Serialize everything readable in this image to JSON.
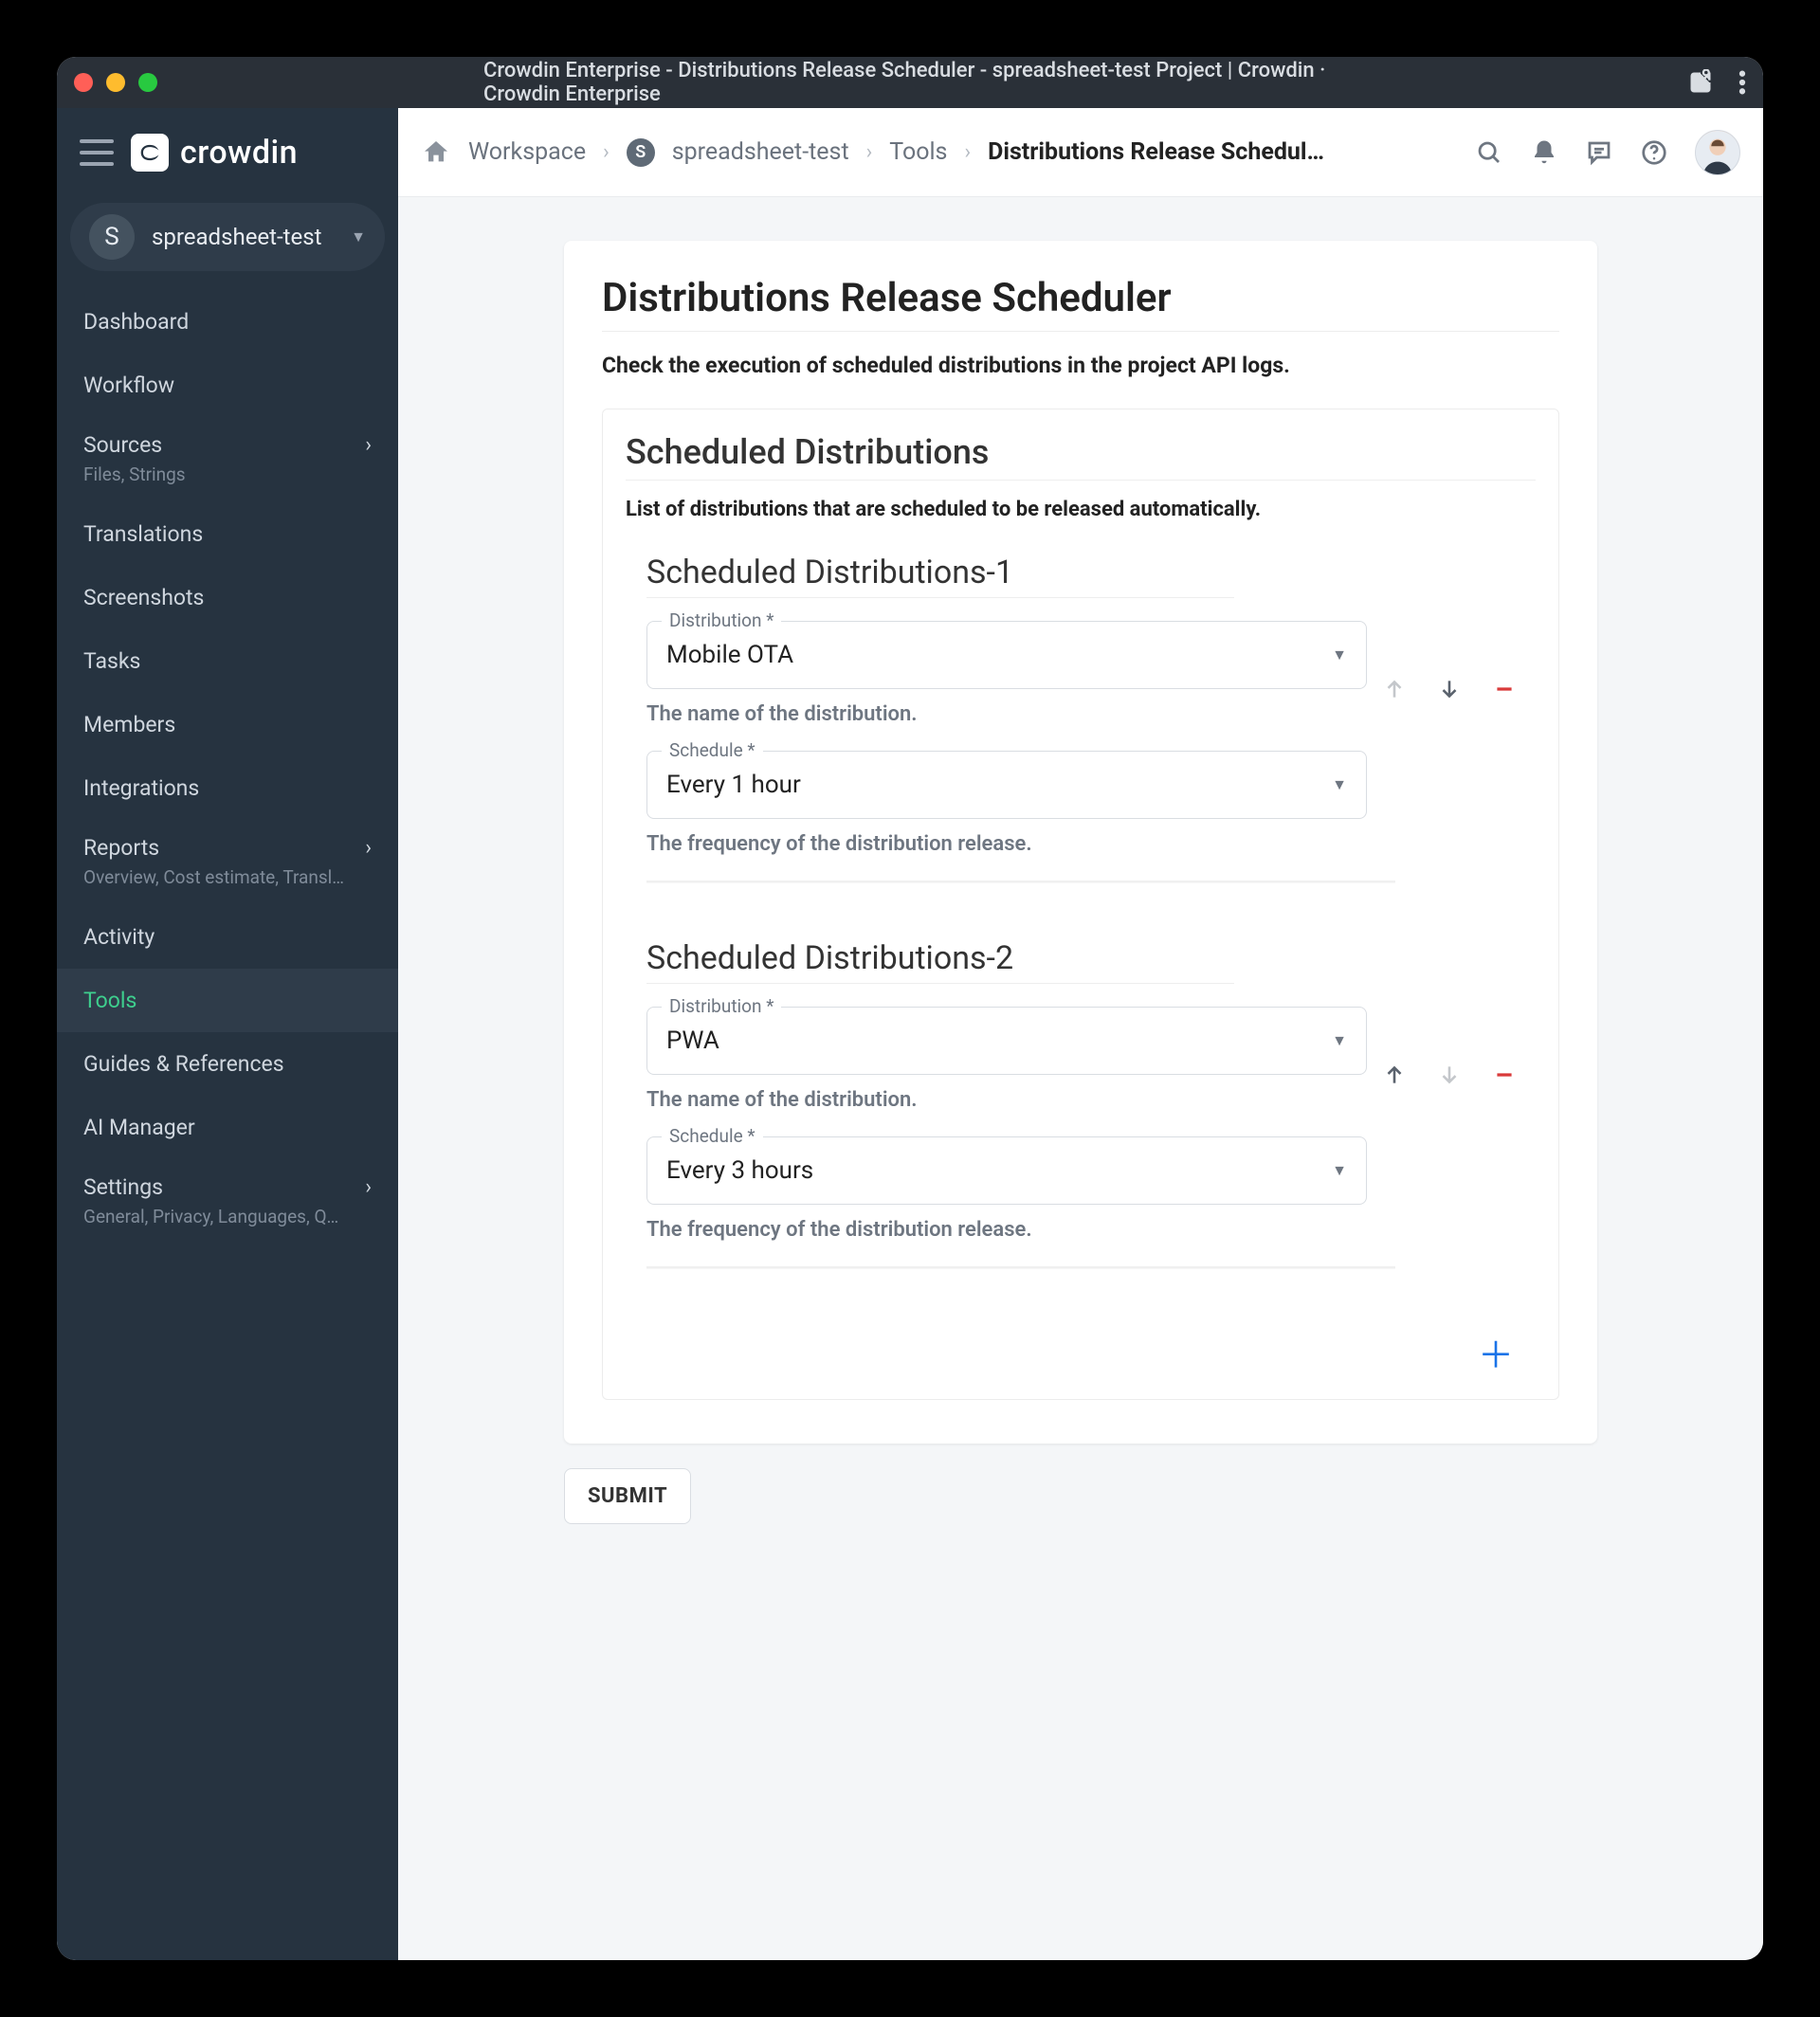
{
  "window": {
    "title": "Crowdin Enterprise - Distributions Release Scheduler - spreadsheet-test Project | Crowdin · Crowdin Enterprise"
  },
  "logo_text": "crowdin",
  "project": {
    "initial": "S",
    "name": "spreadsheet-test"
  },
  "sidebar": {
    "items": [
      {
        "label": "Dashboard"
      },
      {
        "label": "Workflow"
      },
      {
        "label": "Sources",
        "sub": "Files, Strings",
        "expandable": true
      },
      {
        "label": "Translations"
      },
      {
        "label": "Screenshots"
      },
      {
        "label": "Tasks"
      },
      {
        "label": "Members"
      },
      {
        "label": "Integrations"
      },
      {
        "label": "Reports",
        "sub": "Overview, Cost estimate, Transl…",
        "expandable": true
      },
      {
        "label": "Activity"
      },
      {
        "label": "Tools",
        "active": true
      },
      {
        "label": "Guides & References"
      },
      {
        "label": "AI Manager"
      },
      {
        "label": "Settings",
        "sub": "General, Privacy, Languages, Q…",
        "expandable": true
      }
    ]
  },
  "breadcrumb": {
    "workspace": "Workspace",
    "project_initial": "S",
    "project": "spreadsheet-test",
    "tools": "Tools",
    "current": "Distributions Release Schedul…"
  },
  "page": {
    "title": "Distributions Release Scheduler",
    "subtitle": "Check the execution of scheduled distributions in the project API logs.",
    "section_title": "Scheduled Distributions",
    "section_desc": "List of distributions that are scheduled to be released automatically.",
    "blocks": [
      {
        "title": "Scheduled Distributions-1",
        "distribution_label": "Distribution",
        "distribution_value": "Mobile OTA",
        "distribution_helper": "The name of the distribution.",
        "schedule_label": "Schedule",
        "schedule_value": "Every 1 hour",
        "schedule_helper": "The frequency of the distribution release.",
        "up_enabled": false,
        "down_enabled": true
      },
      {
        "title": "Scheduled Distributions-2",
        "distribution_label": "Distribution",
        "distribution_value": "PWA",
        "distribution_helper": "The name of the distribution.",
        "schedule_label": "Schedule",
        "schedule_value": "Every 3 hours",
        "schedule_helper": "The frequency of the distribution release.",
        "up_enabled": true,
        "down_enabled": false
      }
    ],
    "submit": "SUBMIT",
    "required_mark": "*"
  }
}
